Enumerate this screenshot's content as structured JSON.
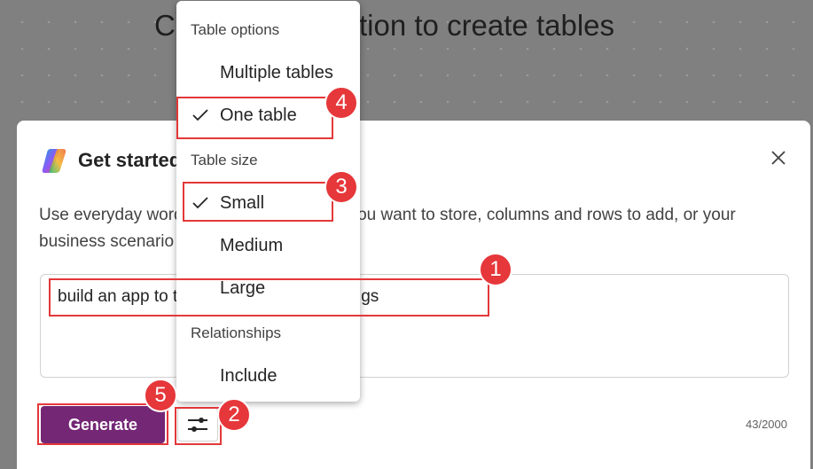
{
  "background": {
    "title": "Use Copilot in Power Apps to create an application to create tables"
  },
  "dialog": {
    "title": "Get started",
    "close_icon": "close-icon",
    "description": "Use everyday words to describe the data you want to store, columns and rows to add, or your business scenario",
    "prompt_text": "build an app to track the property showings",
    "generate_label": "Generate",
    "settings_icon": "sliders-icon",
    "char_counter": "43/2000"
  },
  "menu": {
    "table_options_header": "Table options",
    "multiple_tables": "Multiple tables",
    "one_table": "One table",
    "table_size_header": "Table size",
    "small": "Small",
    "medium": "Medium",
    "large": "Large",
    "relationships_header": "Relationships",
    "include": "Include"
  },
  "annotations": {
    "b1": "1",
    "b2": "2",
    "b3": "3",
    "b4": "4",
    "b5": "5",
    "color": "#e3383a"
  },
  "colors": {
    "generate": "#742774",
    "badge": "#e6373a"
  }
}
